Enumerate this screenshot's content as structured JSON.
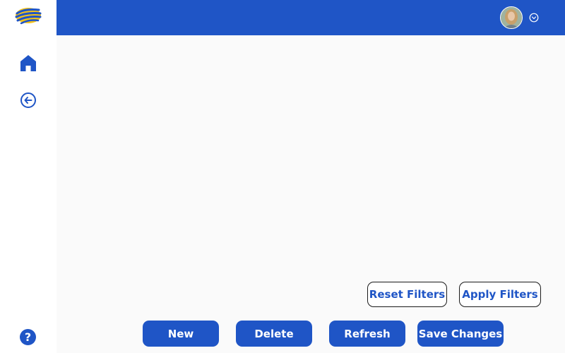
{
  "sidebar": {
    "logo_icon": "brand-logo-icon",
    "items": [
      {
        "icon": "home-icon"
      },
      {
        "icon": "arrow-left-circle-icon"
      }
    ],
    "help_label": "?"
  },
  "header": {
    "avatar_icon": "user-avatar",
    "menu_icon": "chevron-down-circle-icon"
  },
  "filters": {
    "reset_label": "Reset Filters",
    "apply_label": "Apply Filters"
  },
  "actions": {
    "new_label": "New",
    "delete_label": "Delete",
    "refresh_label": "Refresh",
    "save_label": "Save Changes"
  },
  "colors": {
    "primary": "#1f55c6",
    "logo_yellow": "#f2c21b",
    "background": "#fafafa"
  }
}
